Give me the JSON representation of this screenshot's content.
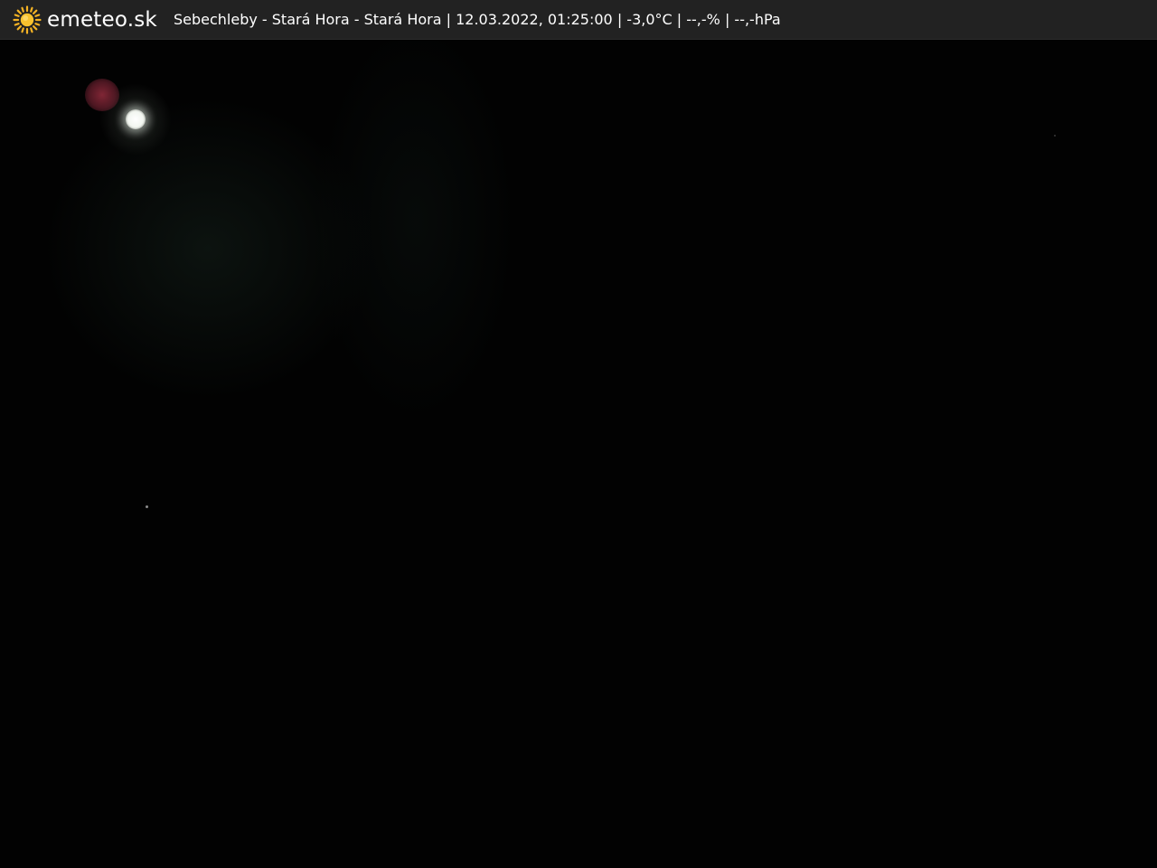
{
  "header": {
    "brand": "emeteo.sk",
    "logo_icon": "sun-icon",
    "caption": "Sebechleby - Stará Hora - Stará Hora | 12.03.2022, 01:25:00 | -3,0°C | --,-% | --,-hPa"
  },
  "colors": {
    "bar_background": "#222222",
    "sun": "#f5b324",
    "text": "#ffffff",
    "sky": "#020202"
  }
}
